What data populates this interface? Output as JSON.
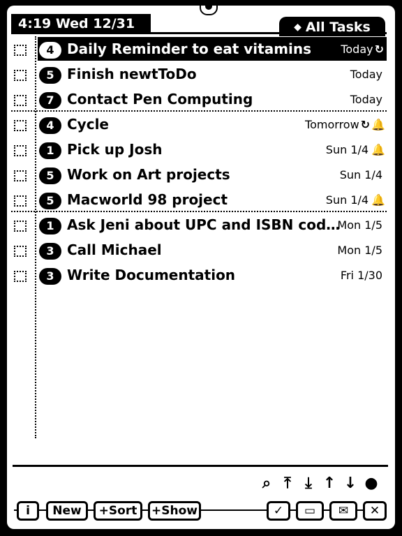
{
  "status": {
    "clock": "4:19 Wed 12/31",
    "filter_label": "All Tasks",
    "filter_icon": "diamond-icon"
  },
  "tasks": [
    {
      "priority": "4",
      "title": "Daily Reminder to eat vitamins",
      "due": "Today",
      "repeat": "↻",
      "alarm": "",
      "selected": true
    },
    {
      "priority": "5",
      "title": "Finish newtToDo",
      "due": "Today",
      "repeat": "",
      "alarm": ""
    },
    {
      "priority": "7",
      "title": "Contact Pen Computing",
      "due": "Today",
      "repeat": "",
      "alarm": ""
    },
    {
      "priority": "4",
      "title": "Cycle",
      "due": "Tomorrow",
      "repeat": "↻",
      "alarm": "🔔"
    },
    {
      "priority": "1",
      "title": "Pick up Josh",
      "due": "Sun 1/4",
      "repeat": "",
      "alarm": "🔔"
    },
    {
      "priority": "5",
      "title": "Work on Art projects",
      "due": "Sun 1/4",
      "repeat": "",
      "alarm": ""
    },
    {
      "priority": "5",
      "title": "Macworld 98 project",
      "due": "Sun 1/4",
      "repeat": "",
      "alarm": "🔔"
    },
    {
      "priority": "1",
      "title": "Ask Jeni about UPC and ISBN cod…",
      "due": "Mon 1/5",
      "repeat": "",
      "alarm": ""
    },
    {
      "priority": "3",
      "title": "Call Michael",
      "due": "Mon 1/5",
      "repeat": "",
      "alarm": ""
    },
    {
      "priority": "3",
      "title": "Write Documentation",
      "due": "Fri 1/30",
      "repeat": "",
      "alarm": ""
    }
  ],
  "actions": {
    "find_icon": "⌕",
    "move_top_icon": "⤒",
    "move_bottom_icon": "⤓",
    "move_up_icon": "↑",
    "move_down_icon": "↓",
    "dot_icon": "●"
  },
  "toolbar": {
    "info": "i",
    "new": "New",
    "sort": "+Sort",
    "show": "+Show",
    "check": "✓",
    "folder": "▭",
    "mail": "✉",
    "close": "✕"
  }
}
